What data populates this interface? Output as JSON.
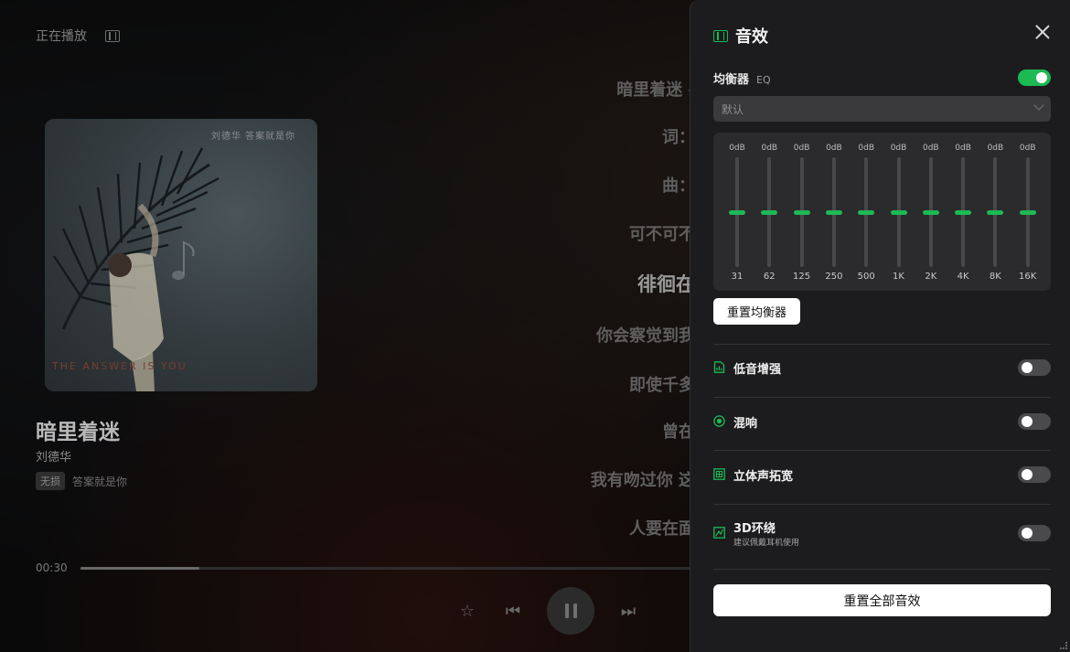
{
  "player": {
    "header_title": "正在播放",
    "cover_note": "刘德华 答案就是你",
    "cover_bottom_text": "THE ANSWER IS YOU",
    "song_title": "暗里着迷",
    "artist": "刘德华",
    "tag": "无损",
    "album": "答案就是你",
    "current_time": "00:30",
    "progress_fraction": 0.195,
    "lyrics": [
      {
        "text": "暗里着迷 -",
        "active": false
      },
      {
        "text": "词：",
        "active": false
      },
      {
        "text": "曲：",
        "active": false
      },
      {
        "text": "可不可不",
        "active": false
      },
      {
        "text": "徘徊在",
        "active": true
      },
      {
        "text": "你会察觉到我",
        "active": false
      },
      {
        "text": "即使千多",
        "active": false
      },
      {
        "text": "曾在",
        "active": false
      },
      {
        "text": "我有吻过你 这",
        "active": false
      },
      {
        "text": "人要在面",
        "active": false
      }
    ]
  },
  "panel": {
    "title": "音效",
    "equalizer": {
      "label": "均衡器",
      "sub": "EQ",
      "enabled": true,
      "preset": "默认",
      "bands": [
        {
          "freq": "31",
          "db": "0dB",
          "gain": 0
        },
        {
          "freq": "62",
          "db": "0dB",
          "gain": 0
        },
        {
          "freq": "125",
          "db": "0dB",
          "gain": 0
        },
        {
          "freq": "250",
          "db": "0dB",
          "gain": 0
        },
        {
          "freq": "500",
          "db": "0dB",
          "gain": 0
        },
        {
          "freq": "1K",
          "db": "0dB",
          "gain": 0
        },
        {
          "freq": "2K",
          "db": "0dB",
          "gain": 0
        },
        {
          "freq": "4K",
          "db": "0dB",
          "gain": 0
        },
        {
          "freq": "8K",
          "db": "0dB",
          "gain": 0
        },
        {
          "freq": "16K",
          "db": "0dB",
          "gain": 0
        }
      ],
      "reset_label": "重置均衡器"
    },
    "effects": [
      {
        "label": "低音增强",
        "sub": "",
        "enabled": false,
        "icon": "bass-icon"
      },
      {
        "label": "混响",
        "sub": "",
        "enabled": false,
        "icon": "reverb-icon"
      },
      {
        "label": "立体声拓宽",
        "sub": "",
        "enabled": false,
        "icon": "stereo-icon"
      },
      {
        "label": "3D环绕",
        "sub": "建议佩戴耳机使用",
        "enabled": false,
        "icon": "surround-3d-icon"
      }
    ],
    "reset_all_label": "重置全部音效"
  },
  "colors": {
    "accent": "#1db954",
    "panel_bg": "#1c1c1e",
    "eq_box_bg": "#2b2b2d"
  }
}
